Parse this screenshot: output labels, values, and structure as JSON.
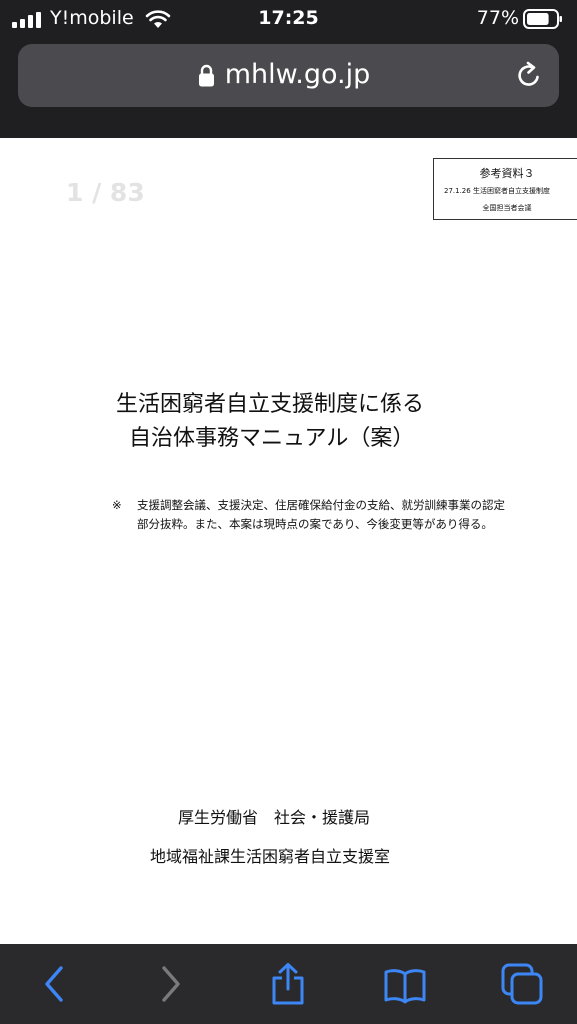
{
  "status_bar": {
    "carrier": "Y!mobile",
    "time": "17:25",
    "battery_percent": "77%",
    "battery_level": 0.77
  },
  "address_bar": {
    "url": "mhlw.go.jp"
  },
  "document": {
    "page_counter": "1 / 83",
    "reference_box": {
      "title": "参考資料３",
      "line2": "27.1.26 生活困窮者自立支援制度",
      "line3": "全国担当者会議"
    },
    "title_line1": "生活困窮者自立支援制度に係る",
    "title_line2": "自治体事務マニュアル（案）",
    "note_mark": "※",
    "note_line1": "支援調整会議、支援決定、住居確保給付金の支給、就労訓練事業の認定",
    "note_line2": "部分抜粋。また、本案は現時点の案であり、今後変更等があり得る。",
    "ministry": "厚生労働省　社会・援護局",
    "office": "地域福祉課生活困窮者自立支援室"
  },
  "toolbar": {
    "items": [
      "back-icon",
      "forward-icon",
      "share-icon",
      "bookmarks-icon",
      "tabs-icon"
    ],
    "accent_color": "#3d86f5",
    "disabled_color": "#7a7a7e"
  }
}
